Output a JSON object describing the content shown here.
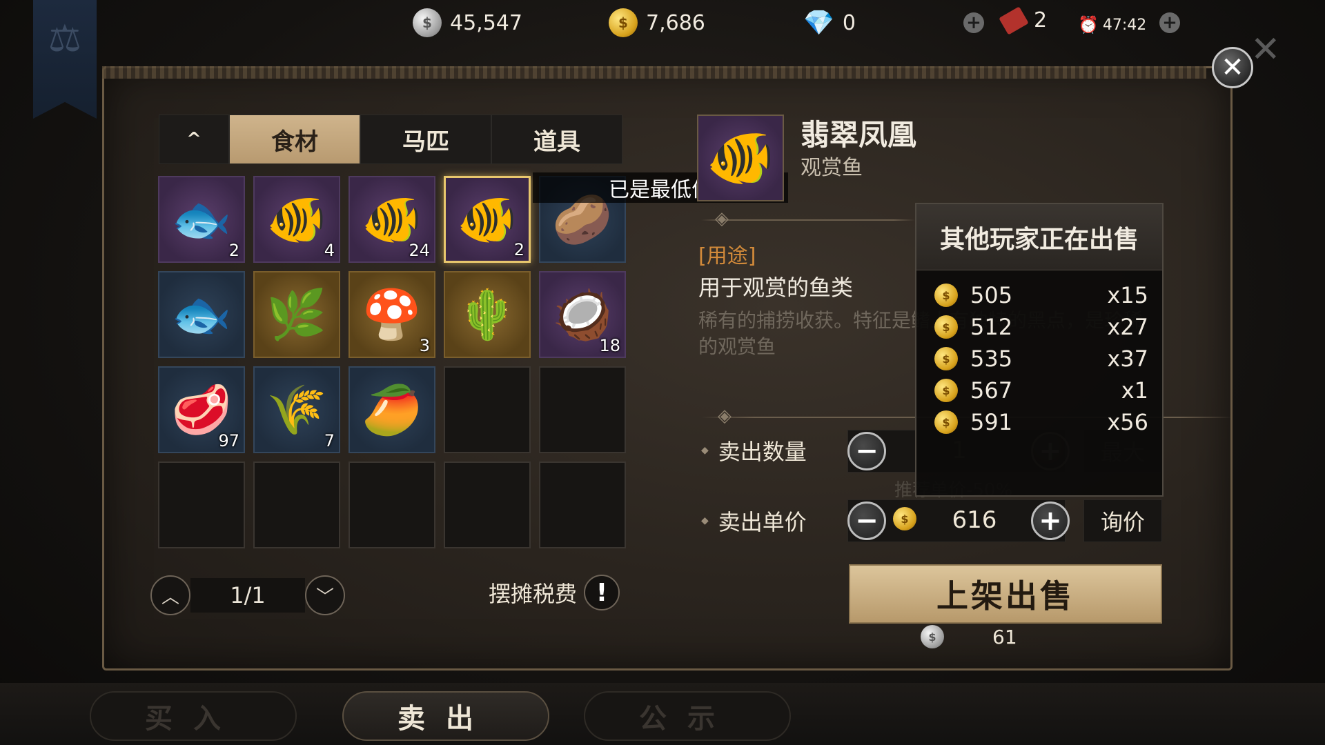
{
  "currencies": {
    "silver": "45,547",
    "gold": "7,686",
    "diamond": "0",
    "tickets": "2",
    "timer": "47:42"
  },
  "icons": {
    "silver_coin": "silver-coin-icon",
    "gold_coin": "gold-coin-icon",
    "diamond": "diamond-icon",
    "ticket": "ticket-icon",
    "alarm": "alarm-clock-icon",
    "scale": "scale-icon"
  },
  "tabs": {
    "collapse": "^",
    "items": [
      {
        "label": "食材",
        "active": true
      },
      {
        "label": "马匹",
        "active": false
      },
      {
        "label": "道具",
        "active": false
      }
    ]
  },
  "inventory": [
    {
      "icon": "sunfish",
      "glyph": "🐟",
      "rarity": "purple",
      "count": "2"
    },
    {
      "icon": "catfish",
      "glyph": "🐠",
      "rarity": "purple",
      "count": "4"
    },
    {
      "icon": "angelfish",
      "glyph": "🐠",
      "rarity": "purple",
      "count": "24"
    },
    {
      "icon": "emerald-phoenix-fish",
      "glyph": "🐠",
      "rarity": "purple",
      "count": "2",
      "selected": true
    },
    {
      "icon": "abalone",
      "glyph": "🥔",
      "rarity": "blue",
      "count": ""
    },
    {
      "icon": "grouper",
      "glyph": "🐟",
      "rarity": "blue",
      "count": ""
    },
    {
      "icon": "ginseng-root",
      "glyph": "🌿",
      "rarity": "gold",
      "count": ""
    },
    {
      "icon": "truffle",
      "glyph": "🍄",
      "rarity": "gold",
      "count": "3"
    },
    {
      "icon": "aloe-plant",
      "glyph": "🌵",
      "rarity": "gold",
      "count": ""
    },
    {
      "icon": "cocoa-beans",
      "glyph": "🥥",
      "rarity": "purple",
      "count": "18"
    },
    {
      "icon": "raw-meat",
      "glyph": "🥩",
      "rarity": "blue",
      "count": "97"
    },
    {
      "icon": "rice-stalks",
      "glyph": "🌾",
      "rarity": "blue",
      "count": "7"
    },
    {
      "icon": "mango",
      "glyph": "🥭",
      "rarity": "blue",
      "count": ""
    }
  ],
  "tooltip": "已是最低价",
  "pager": {
    "text": "1/1"
  },
  "tax_label": "摆摊税费",
  "tax_icon": "!",
  "item": {
    "name": "翡翠凤凰",
    "type": "观赏鱼",
    "use_label": "[用途]",
    "use_text": "用于观赏的鱼类",
    "description": "稀有的捕捞收获。特征是鳍上有独特的黑点，是珍稀的观赏鱼"
  },
  "sell": {
    "quantity_label": "卖出数量",
    "quantity_value": "1",
    "max_label": "最大",
    "recommend_text": "推荐单价-50%",
    "price_label": "卖出单价",
    "price_value": "616",
    "inquire_label": "询价",
    "list_button": "上架出售",
    "fee": "61"
  },
  "market": {
    "title": "其他玩家正在出售",
    "listings": [
      {
        "price": "505",
        "qty": "x15"
      },
      {
        "price": "512",
        "qty": "x27"
      },
      {
        "price": "535",
        "qty": "x37"
      },
      {
        "price": "567",
        "qty": "x1"
      },
      {
        "price": "591",
        "qty": "x56"
      }
    ]
  },
  "bottom_nav": [
    {
      "label": "买入",
      "active": false
    },
    {
      "label": "卖出",
      "active": true
    },
    {
      "label": "公示",
      "active": false
    }
  ]
}
